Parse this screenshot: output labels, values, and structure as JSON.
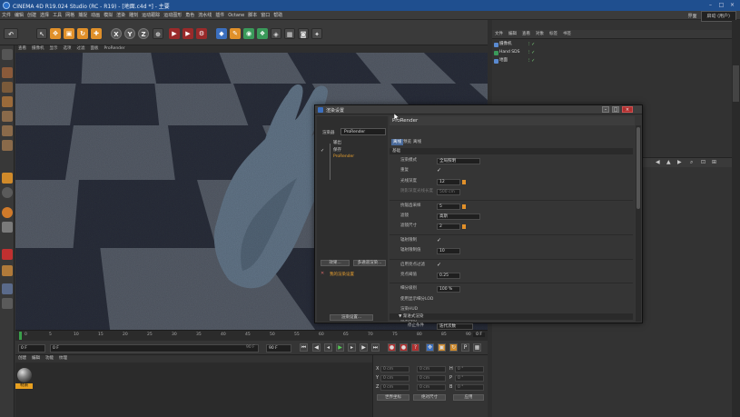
{
  "window": {
    "title": "CINEMA 4D R19.024 Studio (RC - R19) - [地面.c4d *] - 主要"
  },
  "menubar": {
    "items": [
      "文件",
      "编辑",
      "创建",
      "选择",
      "工具",
      "网格",
      "捕捉",
      "动画",
      "模拟",
      "渲染",
      "雕刻",
      "运动跟踪",
      "运动图形",
      "角色",
      "流水线",
      "插件",
      "Octane",
      "脚本",
      "窗口",
      "帮助"
    ],
    "layout_label": "界面",
    "layout_value": "启动 (用户)"
  },
  "viewport_menu": [
    "查看",
    "摄像机",
    "显示",
    "选项",
    "过滤",
    "面板",
    "ProRender"
  ],
  "object_manager": {
    "menu": [
      "文件",
      "编辑",
      "查看",
      "对象",
      "标签",
      "书签"
    ],
    "objects": [
      {
        "name": "摄像机",
        "icon_color": "#5a8ad0"
      },
      {
        "name": "Hand SDS",
        "icon_color": "#3a9a5a"
      },
      {
        "name": "地面",
        "icon_color": "#5a8ad0"
      }
    ]
  },
  "timeline": {
    "ticks": [
      "0",
      "5",
      "10",
      "15",
      "20",
      "25",
      "30",
      "35",
      "40",
      "45",
      "50",
      "55",
      "60",
      "65",
      "70",
      "75",
      "80",
      "85",
      "90"
    ],
    "end_frame": "0 F"
  },
  "transport": {
    "current_frame": "0 F",
    "start_frame": "0 F",
    "min_frame": "90 F",
    "max_frame": "90 F"
  },
  "materials": {
    "menu": [
      "创建",
      "编辑",
      "功能",
      "纹理"
    ],
    "material_name": "材质"
  },
  "coordinates": {
    "rows": [
      {
        "axis": "X",
        "pos": "0 cm",
        "size": "0 cm",
        "rot_label": "H",
        "rot": "0 °"
      },
      {
        "axis": "Y",
        "pos": "0 cm",
        "size": "0 cm",
        "rot_label": "P",
        "rot": "0 °"
      },
      {
        "axis": "Z",
        "pos": "0 cm",
        "size": "0 cm",
        "rot_label": "B",
        "rot": "0 °"
      }
    ],
    "mode_world": "世界坐标",
    "mode_scale": "绝对尺寸",
    "apply": "应用"
  },
  "render_settings": {
    "title": "渲染设置",
    "renderer_label": "渲染器",
    "renderer_value": "ProRender",
    "list": [
      {
        "label": "输出",
        "active": false
      },
      {
        "label": "保存",
        "active": false
      },
      {
        "label": "ProRender",
        "active": true
      }
    ],
    "effect_button": "效果...",
    "multipass_button": "多通道渲染...",
    "preset_label": "我的渲染设置",
    "render_settings_button": "渲染设置...",
    "panel_title": "ProRender",
    "tabs": [
      "离线",
      "预览",
      "离线"
    ],
    "section_basic": "基础",
    "section_progressive": "▼ 渐进式渲染",
    "params": [
      {
        "label": "渲染模式",
        "type": "dropdown",
        "value": "全局照明"
      },
      {
        "label": "重复",
        "type": "check",
        "value": "✓"
      },
      {
        "label": "光线深度",
        "type": "number",
        "value": "12",
        "slider": true
      },
      {
        "label": "阴影深度光线长度",
        "type": "number",
        "value": "500 cm",
        "dim": true
      },
      {
        "label": "抗锯齿采样",
        "type": "number",
        "value": "5",
        "slider": true
      },
      {
        "label": "滤镜",
        "type": "dropdown",
        "value": "高斯"
      },
      {
        "label": "滤镜尺寸",
        "type": "number",
        "value": "2",
        "slider": true
      },
      {
        "label": "辐射限制",
        "type": "check",
        "value": "✓"
      },
      {
        "label": "辐射限制值",
        "type": "number",
        "value": "10"
      },
      {
        "label": "启用亮点过滤",
        "type": "check",
        "value": "✓"
      },
      {
        "label": "亮点阈值",
        "type": "number",
        "value": "0.25"
      },
      {
        "label": "细分级别",
        "type": "number",
        "value": "100 %"
      },
      {
        "label": "使用显示细分LOD",
        "type": "check",
        "value": ""
      },
      {
        "label": "渲染HUD",
        "type": "check",
        "value": ""
      },
      {
        "label": "渲染网格",
        "type": "check",
        "value": ""
      }
    ],
    "stop_label": "停止条件",
    "stop_value": "迭代次数"
  },
  "colors": {
    "accent": "#e0902a",
    "titlebar": "#1f4f8f",
    "selection": "#4a6a9a"
  }
}
